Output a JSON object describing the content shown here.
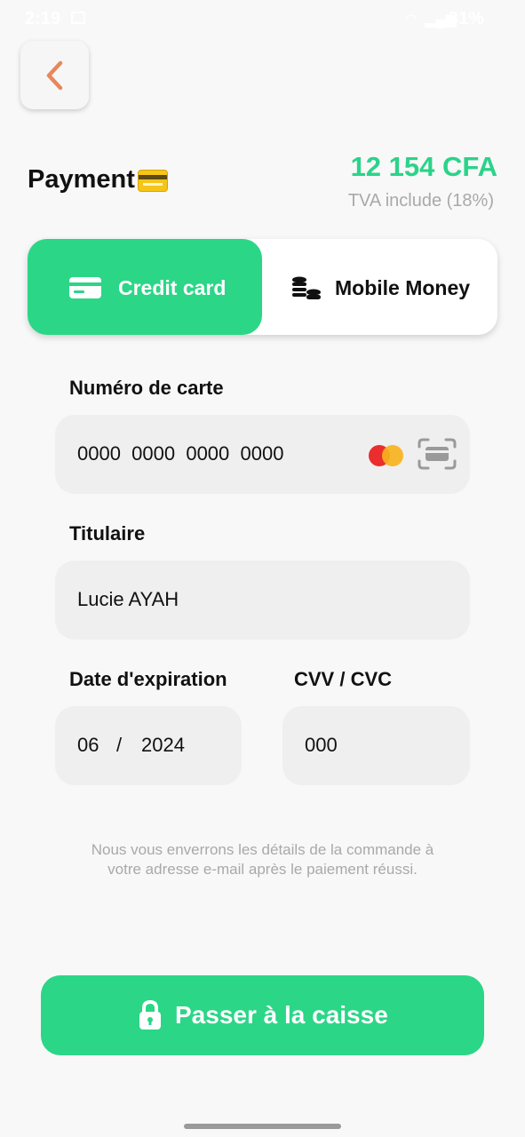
{
  "status_bar": {
    "time": "2:19",
    "battery": "31%"
  },
  "header": {
    "title": "Payment",
    "amount": "12 154 CFA",
    "tax_note": "TVA include (18%)"
  },
  "tabs": {
    "credit_card": "Credit card",
    "mobile_money": "Mobile Money",
    "selected": "credit_card"
  },
  "form": {
    "card_number": {
      "label": "Numéro de carte",
      "value": "0000  0000  0000  0000"
    },
    "holder": {
      "label": "Titulaire",
      "value": "Lucie AYAH"
    },
    "expiry": {
      "label": "Date d'expiration",
      "month": "06",
      "separator": "/",
      "year": "2024"
    },
    "cvv": {
      "label": "CVV / CVC",
      "value": "000"
    }
  },
  "note": {
    "line1": "Nous vous enverrons les détails de la commande à",
    "line2": "votre adresse e-mail après le paiement réussi."
  },
  "checkout": {
    "label": "Passer à la caisse"
  },
  "colors": {
    "accent": "#2bd687",
    "amount": "#2bd38a",
    "back_arrow": "#e8875a",
    "field_bg": "#efefef"
  },
  "icons": {
    "back": "chevron-left-icon",
    "title": "credit-card-emoji-icon",
    "credit_tab": "credit-card-icon",
    "mobile_tab": "coins-icon",
    "brand": "mastercard-icon",
    "scan": "scan-card-icon",
    "checkout": "lock-icon"
  }
}
